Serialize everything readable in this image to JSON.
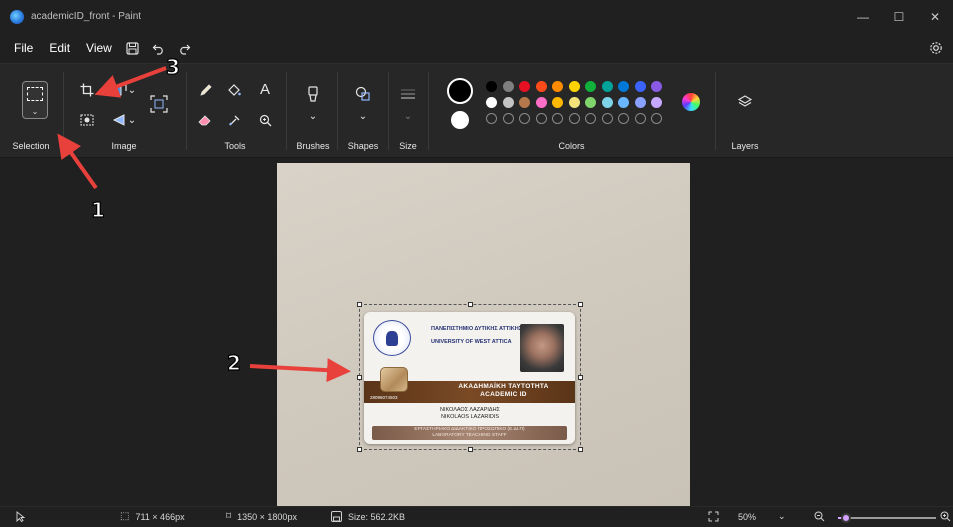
{
  "window": {
    "title": "academicID_front - Paint",
    "controls": {
      "minimize": "—",
      "maximize": "☐",
      "close": "✕"
    }
  },
  "menu": {
    "items": [
      "File",
      "Edit",
      "View"
    ],
    "icons": [
      "save-icon",
      "undo-icon",
      "redo-icon"
    ],
    "settings_icon": "settings-icon"
  },
  "ribbon": {
    "groups": {
      "selection": "Selection",
      "image": "Image",
      "tools": "Tools",
      "brushes": "Brushes",
      "shapes": "Shapes",
      "size": "Size",
      "colors": "Colors",
      "layers": "Layers"
    },
    "tools_text_glyph": "A",
    "primary_color": "#000000",
    "secondary_color": "#ffffff",
    "palette_row1": [
      "#000000",
      "#7f7f7f",
      "#e81123",
      "#ff4a1a",
      "#ff8c00",
      "#ffd400",
      "#10b03a",
      "#00a39a",
      "#0078d7",
      "#3b64ff",
      "#8a5ae6"
    ],
    "palette_row2": [
      "#ffffff",
      "#c3c3c3",
      "#b5784a",
      "#ff6ec7",
      "#ffb900",
      "#f3e37a",
      "#7fd46b",
      "#7dd3e8",
      "#6ab6ff",
      "#8aa2ff",
      "#c7a8ff"
    ],
    "accent": "#d3a3ff"
  },
  "card": {
    "university_gr": "ΠΑΝΕΠΙΣΤΗΜΙΟ ΔΥΤΙΚΗΣ ΑΤΤΙΚΗΣ",
    "university_en": "UNIVERSITY OF WEST ATTICA",
    "id_title_gr": "ΑΚΑΔΗΜΑΪΚΗ ΤΑΥΤΟΤΗΤΑ",
    "id_title_en": "ACADEMIC ID",
    "number": "28096074503",
    "name_gr": "ΝΙΚΟΛΑΟΣ ΛΑΖΑΡΙΔΗΣ",
    "name_en": "NIKOLAOS LAZARIDIS",
    "staff_gr": "ΕΡΓΑΣΤΗΡΙΑΚΟ ΔΙΔΑΚΤΙΚΟ ΠΡΟΣΩΠΙΚΟ (Ε.ΔΙ.Π)",
    "staff_en": "LABORATORY TEACHING STAFF"
  },
  "annotations": {
    "callout_1": "1",
    "callout_2": "2",
    "callout_3": "3",
    "arrow_color": "#e8413c"
  },
  "status": {
    "pointer_icon": "pointer-icon",
    "selection_size": "711 × 466px",
    "canvas_size": "1350 × 1800px",
    "file_size": "Size: 562.2KB",
    "zoom": "50%",
    "zoom_chevron": "⌄"
  }
}
